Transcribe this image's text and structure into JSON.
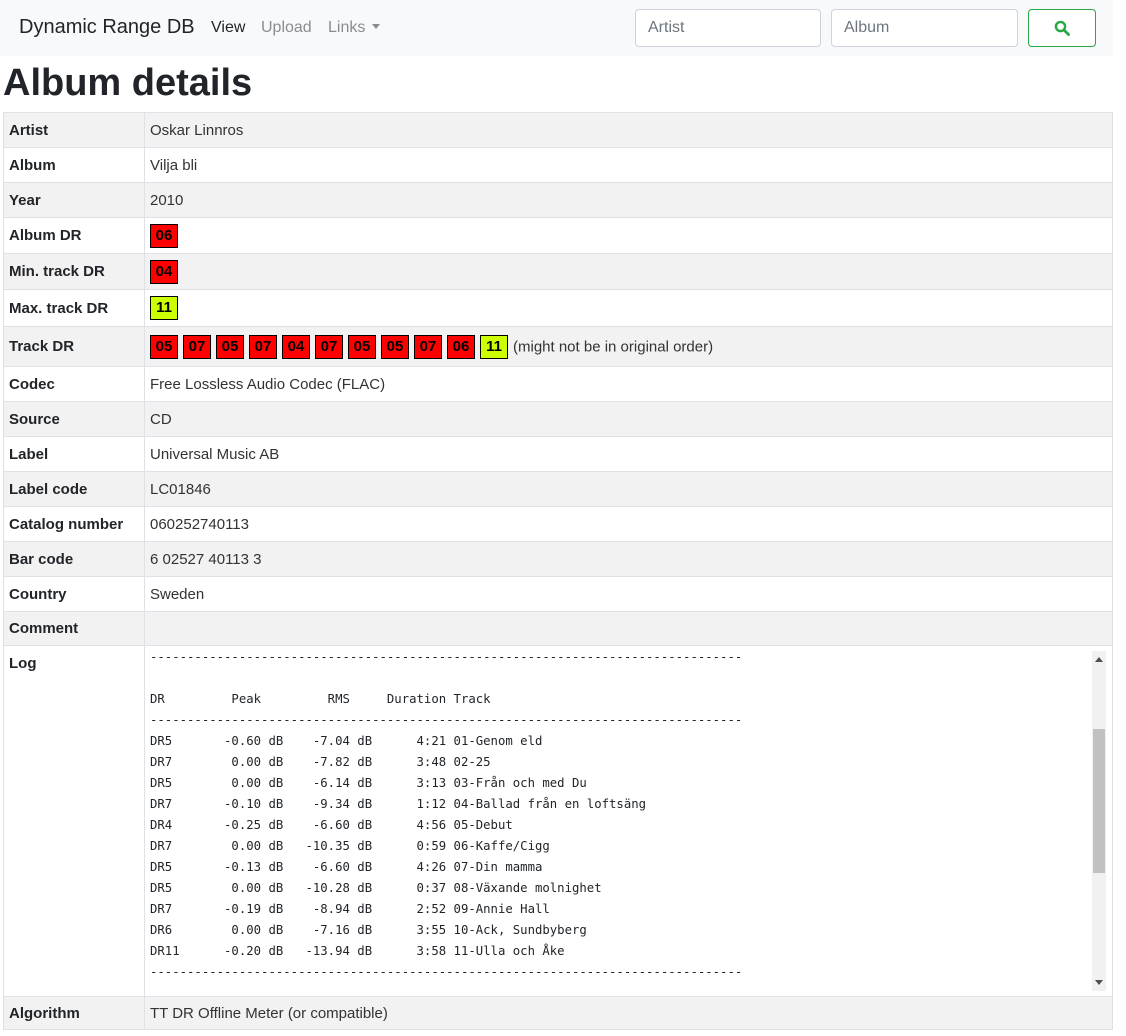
{
  "navbar": {
    "brand": "Dynamic Range DB",
    "view": "View",
    "upload": "Upload",
    "links": "Links",
    "artist_placeholder": "Artist",
    "album_placeholder": "Album"
  },
  "heading": "Album details",
  "details": {
    "artist": {
      "label": "Artist",
      "value": "Oskar Linnros"
    },
    "album": {
      "label": "Album",
      "value": "Vilja bli"
    },
    "year": {
      "label": "Year",
      "value": "2010"
    },
    "album_dr": {
      "label": "Album DR",
      "value": "06"
    },
    "min_track_dr": {
      "label": "Min. track DR",
      "value": "04"
    },
    "max_track_dr": {
      "label": "Max. track DR",
      "value": "11"
    },
    "track_dr": {
      "label": "Track DR",
      "values": [
        "05",
        "07",
        "05",
        "07",
        "04",
        "07",
        "05",
        "05",
        "07",
        "06",
        "11"
      ],
      "note": "(might not be in original order)"
    },
    "codec": {
      "label": "Codec",
      "value": "Free Lossless Audio Codec (FLAC)"
    },
    "source": {
      "label": "Source",
      "value": "CD"
    },
    "label": {
      "label": "Label",
      "value": "Universal Music AB"
    },
    "label_code": {
      "label": "Label code",
      "value": "LC01846"
    },
    "catalog_number": {
      "label": "Catalog number",
      "value": "060252740113"
    },
    "bar_code": {
      "label": "Bar code",
      "value": "6 02527 40113 3"
    },
    "country": {
      "label": "Country",
      "value": "Sweden"
    },
    "comment": {
      "label": "Comment",
      "value": ""
    },
    "log": {
      "label": "Log"
    },
    "algorithm": {
      "label": "Algorithm",
      "value": "TT DR Offline Meter (or compatible)"
    }
  },
  "log_lines": [
    "--------------------------------------------------------------------------------",
    "",
    "DR         Peak         RMS     Duration Track",
    "--------------------------------------------------------------------------------",
    "DR5       -0.60 dB    -7.04 dB      4:21 01-Genom eld",
    "DR7        0.00 dB    -7.82 dB      3:48 02-25",
    "DR5        0.00 dB    -6.14 dB      3:13 03-Från och med Du",
    "DR7       -0.10 dB    -9.34 dB      1:12 04-Ballad från en loftsäng",
    "DR4       -0.25 dB    -6.60 dB      4:56 05-Debut",
    "DR7        0.00 dB   -10.35 dB      0:59 06-Kaffe/Cigg",
    "DR5       -0.13 dB    -6.60 dB      4:26 07-Din mamma",
    "DR5        0.00 dB   -10.28 dB      0:37 08-Växande molnighet",
    "DR7       -0.19 dB    -8.94 dB      2:52 09-Annie Hall",
    "DR6        0.00 dB    -7.16 dB      3:55 10-Ack, Sundbyberg",
    "DR11      -0.20 dB   -13.94 dB      3:58 11-Ulla och Åke",
    "--------------------------------------------------------------------------------"
  ],
  "log_scroll": {
    "thumb_start_fraction": 0.2,
    "thumb_size_fraction": 0.47
  },
  "colors": {
    "dr_low": "#ff0000",
    "dr_high": "#ccff00",
    "search_accent": "#28a745"
  }
}
